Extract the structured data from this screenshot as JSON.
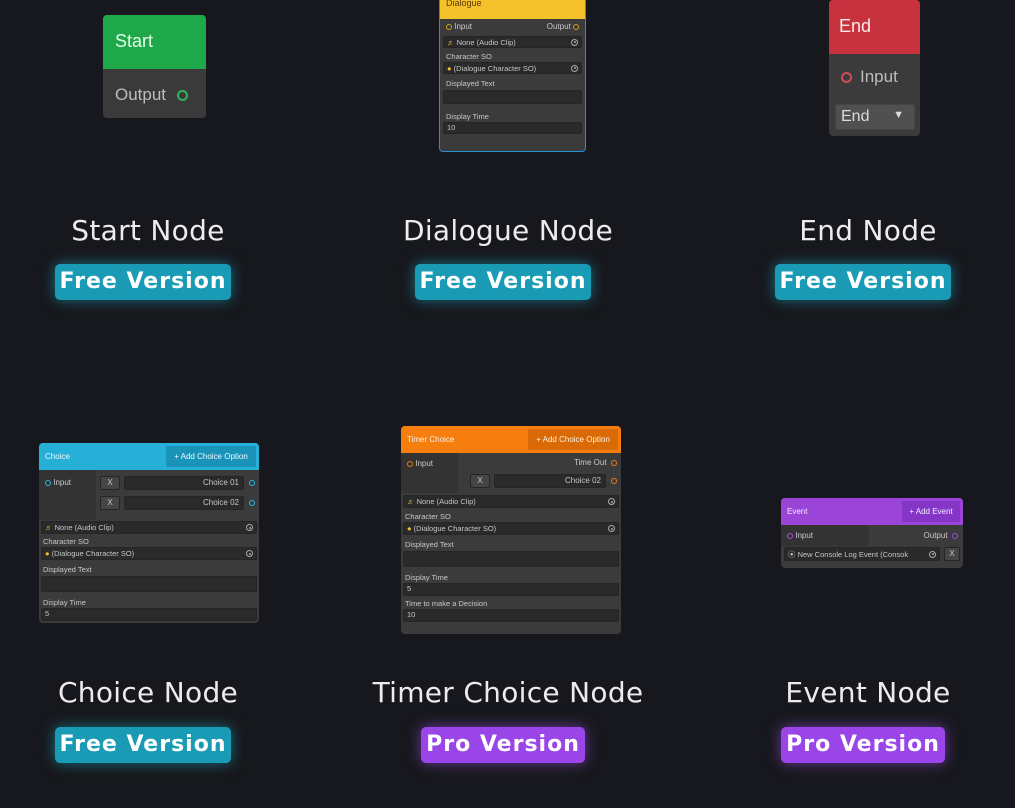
{
  "nodes": {
    "start": {
      "header": "Start",
      "output": "Output"
    },
    "dialogue": {
      "header": "Dialogue",
      "input": "Input",
      "output": "Output",
      "audio": "None (Audio Clip)",
      "character_label": "Character SO",
      "character_value": "(Dialogue Character SO)",
      "displayed_text_label": "Displayed Text",
      "display_time_label": "Display Time",
      "display_time_value": "10"
    },
    "end": {
      "header": "End",
      "input": "Input",
      "dropdown": "End"
    },
    "choice": {
      "header": "Choice",
      "add_option": "+ Add Choice Option",
      "input": "Input",
      "remove_1": "X",
      "choice_1": "Choice 01",
      "remove_2": "X",
      "choice_2": "Choice 02",
      "audio": "None (Audio Clip)",
      "character_label": "Character SO",
      "character_value": "(Dialogue Character SO)",
      "displayed_text_label": "Displayed Text",
      "display_time_label": "Display Time",
      "display_time_value": "5"
    },
    "timer_choice": {
      "header": "Timer Choice",
      "add_option": "+ Add Choice Option",
      "input": "Input",
      "time_out": "Time Out",
      "remove_2": "X",
      "choice_2": "Choice 02",
      "audio": "None (Audio Clip)",
      "character_label": "Character SO",
      "character_value": "(Dialogue Character SO)",
      "displayed_text_label": "Displayed Text",
      "display_time_label": "Display Time",
      "display_time_value": "5",
      "decision_label": "Time to make a Decision",
      "decision_value": "10"
    },
    "event": {
      "header": "Event",
      "add_event": "+ Add Event",
      "input": "Input",
      "output": "Output",
      "event_value": "New Console Log Event (Consok",
      "remove": "X"
    }
  },
  "cards": [
    {
      "title": "Start Node",
      "badge": "Free Version"
    },
    {
      "title": "Dialogue Node",
      "badge": "Free Version"
    },
    {
      "title": "End Node",
      "badge": "Free Version"
    },
    {
      "title": "Choice Node",
      "badge": "Free Version"
    },
    {
      "title": "Timer Choice Node",
      "badge": "Pro Version"
    },
    {
      "title": "Event Node",
      "badge": "Pro Version"
    }
  ],
  "colors": {
    "background": "#17181d",
    "start": "#1fa84a",
    "dialogue": "#f6c22c",
    "end": "#c8323f",
    "choice": "#26b0d8",
    "timer_choice": "#f57e0e",
    "event": "#9a45d8",
    "free_badge": "#1a9bb5",
    "pro_badge": "#9a45e8"
  }
}
